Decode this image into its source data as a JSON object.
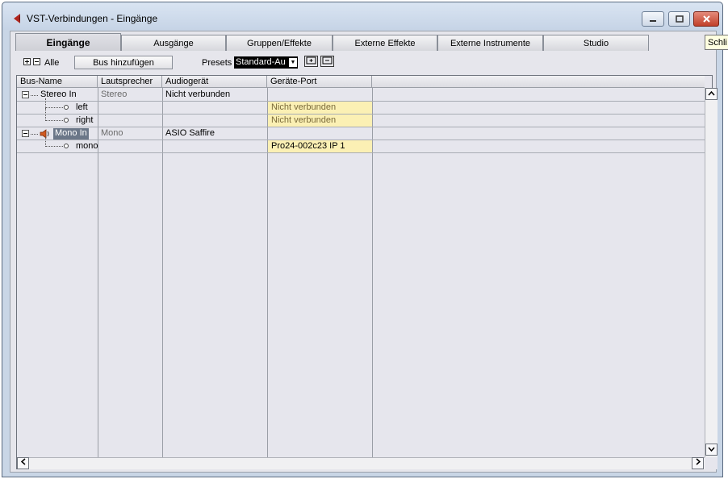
{
  "window": {
    "title": "VST-Verbindungen - Eingänge",
    "tooltip": "Schli"
  },
  "tabs": [
    {
      "label": "Eingänge",
      "active": true
    },
    {
      "label": "Ausgänge",
      "active": false
    },
    {
      "label": "Gruppen/Effekte",
      "active": false
    },
    {
      "label": "Externe Effekte",
      "active": false
    },
    {
      "label": "Externe Instrumente",
      "active": false
    },
    {
      "label": "Studio",
      "active": false
    }
  ],
  "toolbar": {
    "all_label": "Alle",
    "add_bus_label": "Bus hinzufügen",
    "presets_label": "Presets",
    "presets_value": "Standard-Au"
  },
  "table": {
    "columns": [
      "Bus-Name",
      "Lautsprecher",
      "Audiogerät",
      "Geräte-Port"
    ],
    "rows": [
      {
        "name": "Stereo In",
        "speaker": "Stereo",
        "device": "Nicht verbunden",
        "port": ""
      },
      {
        "name": "left",
        "speaker": "",
        "device": "",
        "port": "Nicht verbunden"
      },
      {
        "name": "right",
        "speaker": "",
        "device": "",
        "port": "Nicht verbunden"
      },
      {
        "name": "Mono In",
        "speaker": "Mono",
        "device": "ASIO Saffire",
        "port": ""
      },
      {
        "name": "mono",
        "speaker": "",
        "device": "",
        "port": "Pro24-002c23 IP 1"
      }
    ]
  },
  "colors": {
    "port_highlight": "#fbf0b4",
    "selection": "#6b7788",
    "accent_red": "#c0392b"
  }
}
